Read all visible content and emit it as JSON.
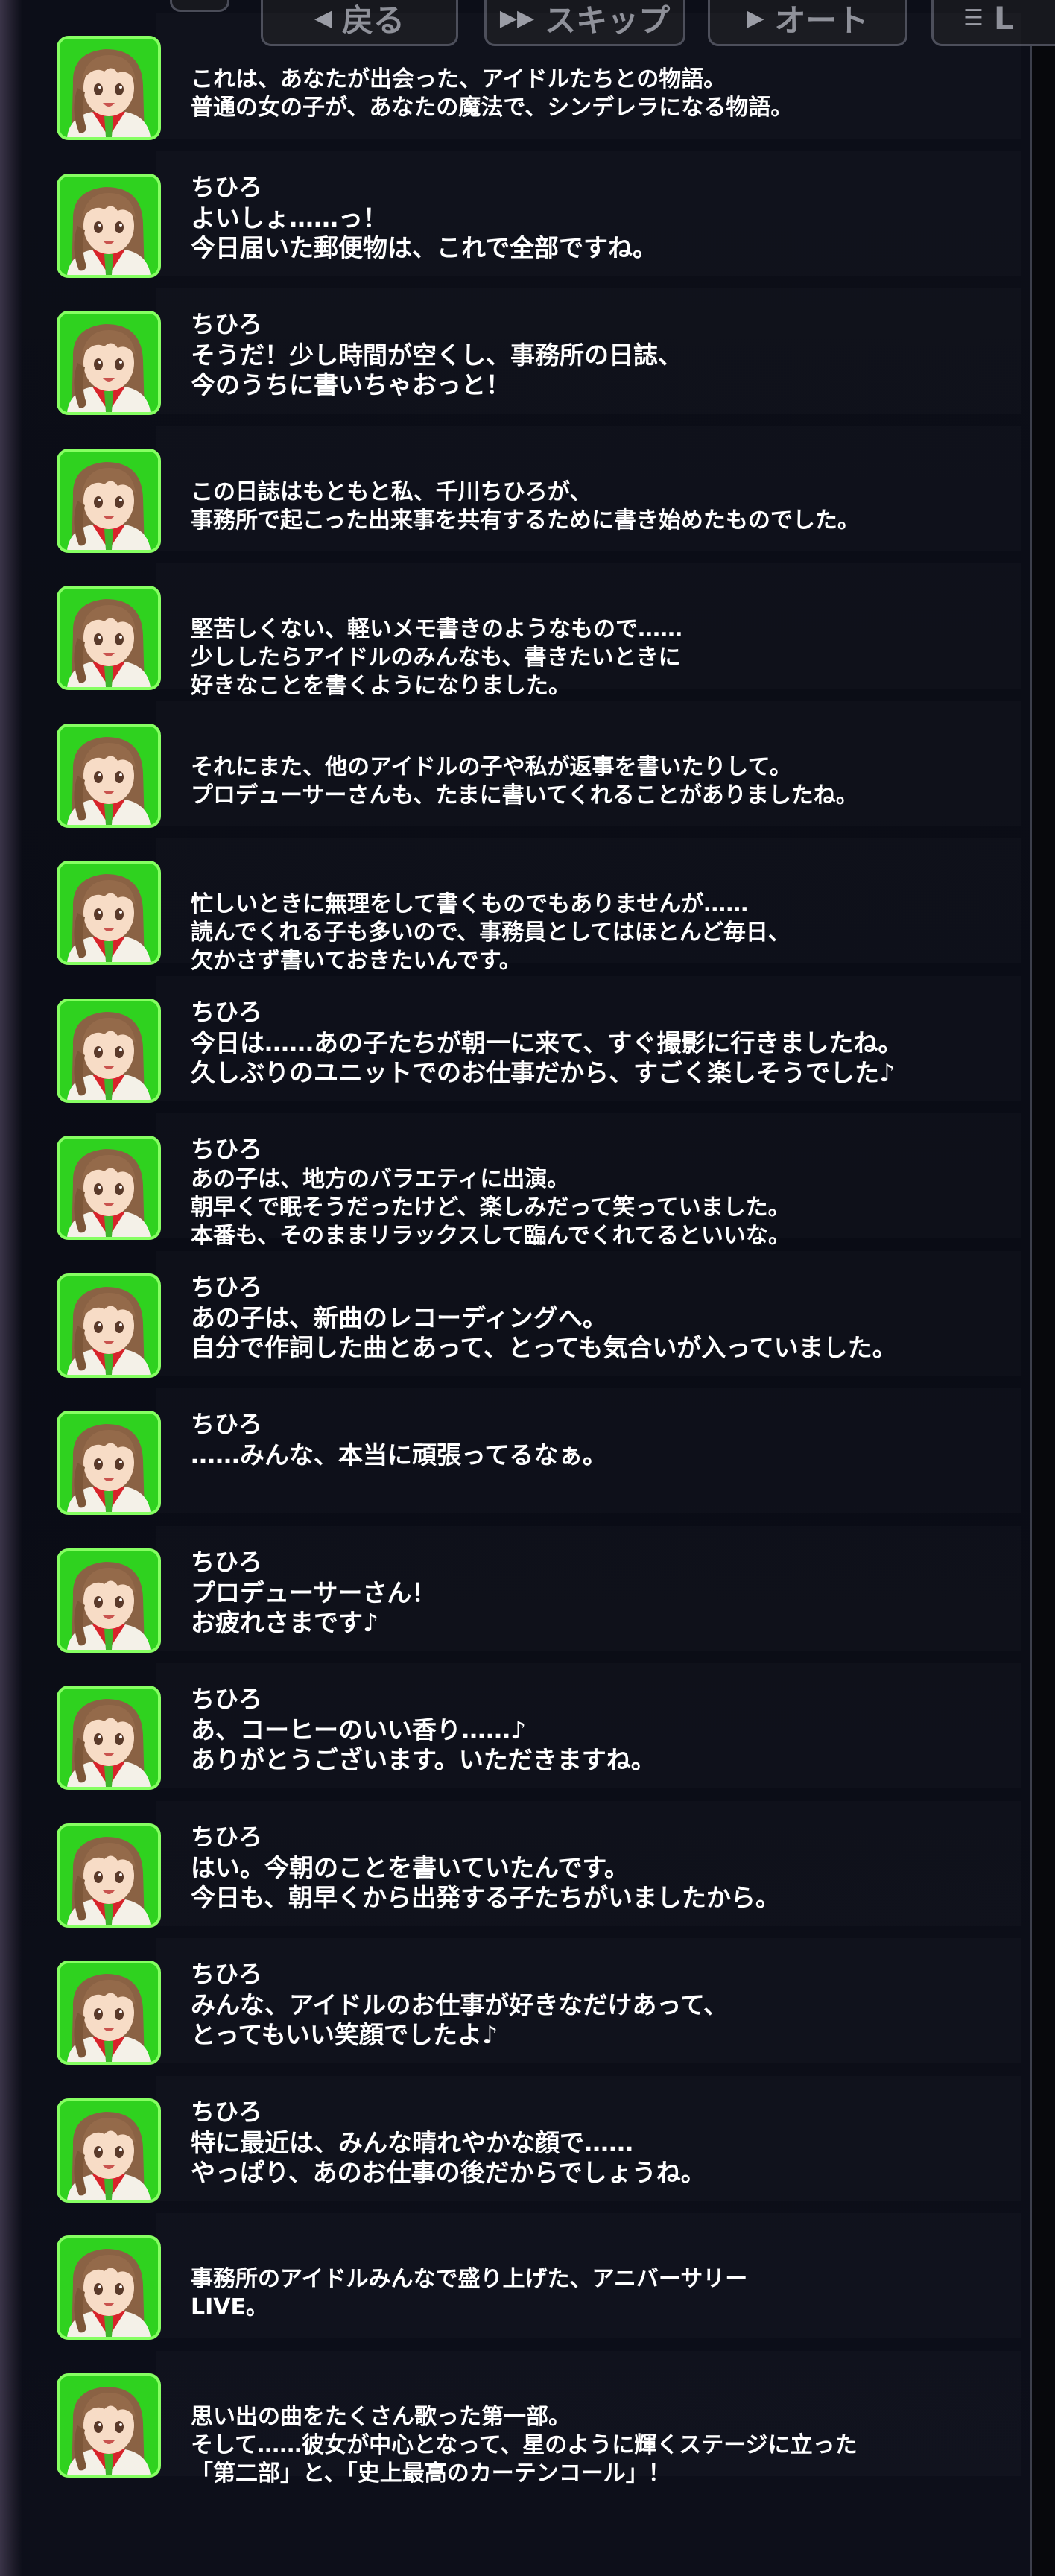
{
  "controls": {
    "back_label": "戻る",
    "skip_label": "スキップ",
    "auto_label": "オート",
    "menu_label": "L"
  },
  "log": [
    {
      "speaker": "",
      "lines": [
        "これは、あなたが出会った、アイドルたちとの物語。",
        "普通の女の子が、あなたの魔法で、シンデレラになる物語。"
      ]
    },
    {
      "speaker": "ちひろ",
      "lines": [
        "よいしょ……っ！",
        "今日届いた郵便物は、これで全部ですね。"
      ]
    },
    {
      "speaker": "ちひろ",
      "lines": [
        "そうだ！少し時間が空くし、事務所の日誌、",
        "今のうちに書いちゃおっと！"
      ]
    },
    {
      "speaker": "",
      "lines": [
        "この日誌はもともと私、千川ちひろが、",
        "事務所で起こった出来事を共有するために書き始めたものでした。"
      ]
    },
    {
      "speaker": "",
      "lines": [
        "堅苦しくない、軽いメモ書きのようなもので……",
        "少ししたらアイドルのみんなも、書きたいときに",
        "好きなことを書くようになりました。"
      ]
    },
    {
      "speaker": "",
      "lines": [
        "それにまた、他のアイドルの子や私が返事を書いたりして。",
        "プロデューサーさんも、たまに書いてくれることがありましたね。"
      ]
    },
    {
      "speaker": "",
      "lines": [
        "忙しいときに無理をして書くものでもありませんが……",
        "読んでくれる子も多いので、事務員としてはほとんど毎日、",
        "欠かさず書いておきたいんです。"
      ]
    },
    {
      "speaker": "ちひろ",
      "lines": [
        "今日は……あの子たちが朝一に来て、すぐ撮影に行きましたね。",
        "久しぶりのユニットでのお仕事だから、すごく楽しそうでした♪"
      ]
    },
    {
      "speaker": "ちひろ",
      "lines": [
        "あの子は、地方のバラエティに出演。",
        "朝早くで眠そうだったけど、楽しみだって笑っていました。",
        "本番も、そのままリラックスして臨んでくれてるといいな。"
      ]
    },
    {
      "speaker": "ちひろ",
      "lines": [
        "あの子は、新曲のレコーディングへ。",
        "自分で作詞した曲とあって、とっても気合いが入っていました。"
      ]
    },
    {
      "speaker": "ちひろ",
      "lines": [
        "……みんな、本当に頑張ってるなぁ。"
      ]
    },
    {
      "speaker": "ちひろ",
      "lines": [
        "プロデューサーさん！",
        "お疲れさまです♪"
      ]
    },
    {
      "speaker": "ちひろ",
      "lines": [
        "あ、コーヒーのいい香り……♪",
        "ありがとうございます。いただきますね。"
      ]
    },
    {
      "speaker": "ちひろ",
      "lines": [
        "はい。今朝のことを書いていたんです。",
        "今日も、朝早くから出発する子たちがいましたから。"
      ]
    },
    {
      "speaker": "ちひろ",
      "lines": [
        "みんな、アイドルのお仕事が好きなだけあって、",
        "とってもいい笑顔でしたよ♪"
      ]
    },
    {
      "speaker": "ちひろ",
      "lines": [
        "特に最近は、みんな晴れやかな顔で……",
        "やっぱり、あのお仕事の後だからでしょうね。"
      ]
    },
    {
      "speaker": "",
      "lines": [
        "事務所のアイドルみんなで盛り上げた、アニバーサリー",
        "LIVE。"
      ]
    },
    {
      "speaker": "",
      "lines": [
        "思い出の曲をたくさん歌った第一部。",
        "そして……彼女が中心となって、星のように輝くステージに立った",
        "「第二部」と、「史上最高のカーテンコール」！"
      ]
    }
  ]
}
